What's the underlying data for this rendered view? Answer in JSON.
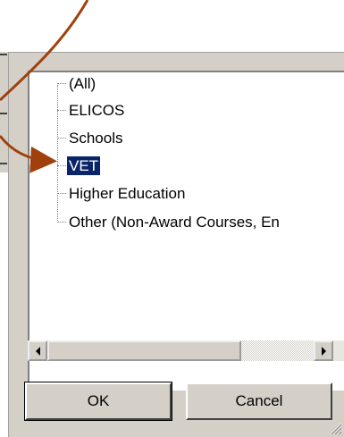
{
  "tree": {
    "items": [
      {
        "label": "(All)"
      },
      {
        "label": "ELICOS"
      },
      {
        "label": "Schools"
      },
      {
        "label": "VET",
        "selected": true
      },
      {
        "label": "Higher Education"
      },
      {
        "label": "Other (Non-Award Courses, En"
      }
    ]
  },
  "buttons": {
    "ok_label": "OK",
    "cancel_label": "Cancel"
  },
  "scrollbar": {
    "orientation": "horizontal",
    "position_fraction": 0.0,
    "visible_fraction": 0.73
  },
  "annotation": {
    "arrow_color": "#a0410d"
  },
  "colors": {
    "dialog_bg": "#d4d0c8",
    "selection_bg": "#0a246a",
    "selection_text": "#ffffff"
  }
}
